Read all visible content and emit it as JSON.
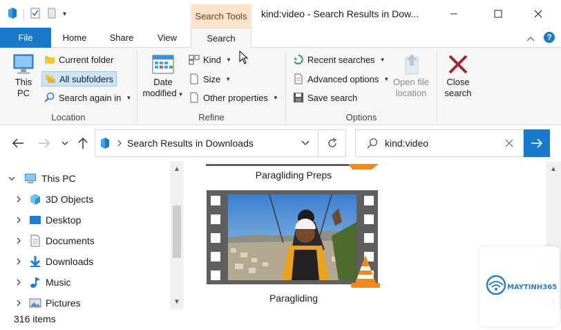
{
  "window": {
    "title": "kind:video - Search Results in Dow...",
    "context_tab": "Search Tools"
  },
  "tabs": {
    "file": "File",
    "home": "Home",
    "share": "Share",
    "view": "View",
    "search": "Search"
  },
  "ribbon": {
    "location": {
      "label": "Location",
      "this_pc_line1": "This",
      "this_pc_line2": "PC",
      "current_folder": "Current folder",
      "all_subfolders": "All subfolders",
      "search_again_in": "Search again in"
    },
    "refine": {
      "label": "Refine",
      "date_modified_line1": "Date",
      "date_modified_line2": "modified",
      "kind": "Kind",
      "size": "Size",
      "other_properties": "Other properties"
    },
    "options": {
      "label": "Options",
      "recent_searches": "Recent searches",
      "advanced_options": "Advanced options",
      "save_search": "Save search",
      "open_file_location_line1": "Open file",
      "open_file_location_line2": "location"
    },
    "close": {
      "line1": "Close",
      "line2": "search"
    }
  },
  "address": {
    "path": "Search Results in Downloads",
    "search_value": "kind:video"
  },
  "nav_tree": [
    {
      "label": "This PC",
      "icon": "computer-icon",
      "expanded": true
    },
    {
      "label": "3D Objects",
      "icon": "3d-objects-icon"
    },
    {
      "label": "Desktop",
      "icon": "desktop-icon"
    },
    {
      "label": "Documents",
      "icon": "documents-icon"
    },
    {
      "label": "Downloads",
      "icon": "downloads-icon"
    },
    {
      "label": "Music",
      "icon": "music-icon"
    },
    {
      "label": "Pictures",
      "icon": "pictures-icon"
    }
  ],
  "files": [
    {
      "name": "Paragliding Preps"
    },
    {
      "name": "Paragliding"
    }
  ],
  "status": {
    "item_count": "316 items"
  },
  "watermark": {
    "text": "MAYTINH365"
  },
  "colors": {
    "accent": "#1979ca",
    "context_tab_bg": "#fce4cc",
    "ribbon_bg": "#f5f6f7",
    "selected_bg": "#cce4f7",
    "close_x": "#a4262c"
  }
}
